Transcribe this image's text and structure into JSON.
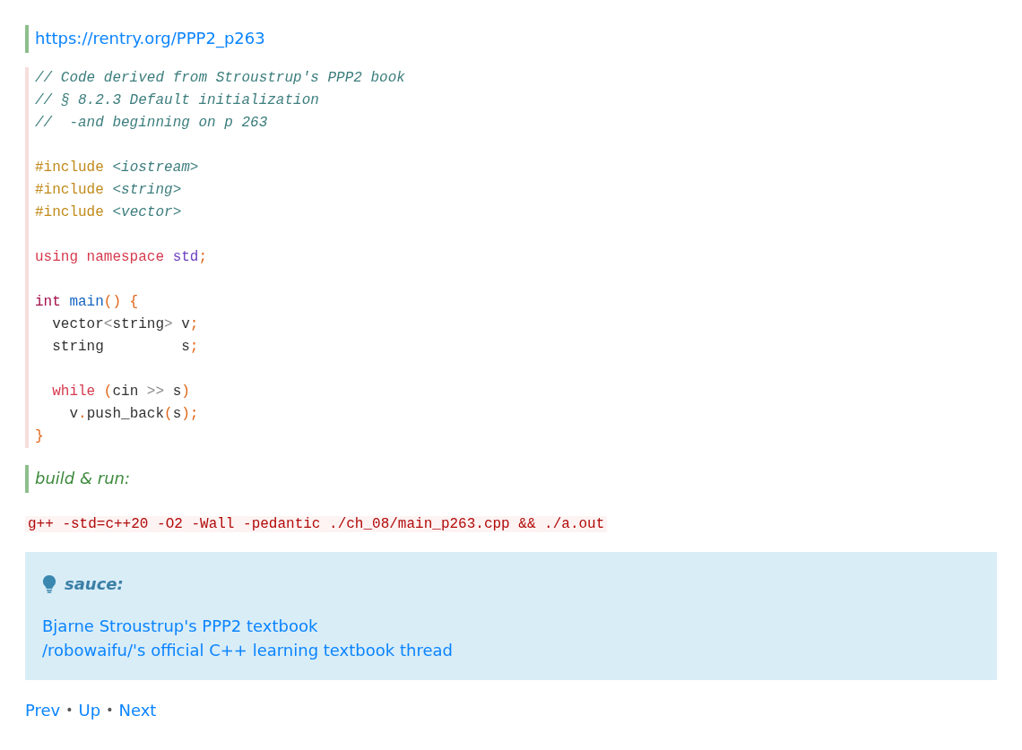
{
  "source_link": "https://rentry.org/PPP2_p263",
  "code": {
    "lines": [
      {
        "kind": "code",
        "tokens": [
          {
            "kind": "comment",
            "text": "// Code derived from Stroustrup's PPP2 book"
          }
        ]
      },
      {
        "kind": "code",
        "tokens": [
          {
            "kind": "comment",
            "text": "// § 8.2.3 Default initialization"
          }
        ]
      },
      {
        "kind": "code",
        "tokens": [
          {
            "kind": "comment",
            "text": "//  -and beginning on p 263"
          }
        ]
      },
      {
        "kind": "blank"
      },
      {
        "kind": "code",
        "tokens": [
          {
            "kind": "preproc",
            "text": "#include "
          },
          {
            "kind": "header",
            "text": "<iostream>"
          }
        ]
      },
      {
        "kind": "code",
        "tokens": [
          {
            "kind": "preproc",
            "text": "#include "
          },
          {
            "kind": "header",
            "text": "<string>"
          }
        ]
      },
      {
        "kind": "code",
        "tokens": [
          {
            "kind": "preproc",
            "text": "#include "
          },
          {
            "kind": "header",
            "text": "<vector>"
          }
        ]
      },
      {
        "kind": "blank"
      },
      {
        "kind": "code",
        "tokens": [
          {
            "kind": "keyword",
            "text": "using namespace "
          },
          {
            "kind": "namespace",
            "text": "std"
          },
          {
            "kind": "punct",
            "text": ";"
          }
        ]
      },
      {
        "kind": "blank"
      },
      {
        "kind": "code",
        "tokens": [
          {
            "kind": "type",
            "text": "int "
          },
          {
            "kind": "function",
            "text": "main"
          },
          {
            "kind": "punct",
            "text": "() {"
          }
        ]
      },
      {
        "kind": "code",
        "tokens": [
          {
            "kind": "plain",
            "text": "  vector"
          },
          {
            "kind": "operator",
            "text": "<"
          },
          {
            "kind": "plain",
            "text": "string"
          },
          {
            "kind": "operator",
            "text": ">"
          },
          {
            "kind": "plain",
            "text": " v"
          },
          {
            "kind": "punct",
            "text": ";"
          }
        ]
      },
      {
        "kind": "code",
        "tokens": [
          {
            "kind": "plain",
            "text": "  string         s"
          },
          {
            "kind": "punct",
            "text": ";"
          }
        ]
      },
      {
        "kind": "blank"
      },
      {
        "kind": "code",
        "tokens": [
          {
            "kind": "keyword",
            "text": "  while "
          },
          {
            "kind": "punct",
            "text": "("
          },
          {
            "kind": "plain",
            "text": "cin "
          },
          {
            "kind": "operator",
            "text": ">>"
          },
          {
            "kind": "plain",
            "text": " s"
          },
          {
            "kind": "punct",
            "text": ")"
          }
        ]
      },
      {
        "kind": "code",
        "tokens": [
          {
            "kind": "plain",
            "text": "    v"
          },
          {
            "kind": "punct",
            "text": "."
          },
          {
            "kind": "plain",
            "text": "push_back"
          },
          {
            "kind": "punct",
            "text": "("
          },
          {
            "kind": "plain",
            "text": "s"
          },
          {
            "kind": "punct",
            "text": ");"
          }
        ]
      },
      {
        "kind": "code",
        "tokens": [
          {
            "kind": "punct",
            "text": "}"
          }
        ]
      }
    ]
  },
  "build_label": "build & run:",
  "command": "g++ -std=c++20 -O2 -Wall -pedantic ./ch_08/main_p263.cpp && ./a.out",
  "note": {
    "title": "sauce:",
    "links": [
      "Bjarne Stroustrup's PPP2 textbook",
      "/robowaifu/'s official C++ learning textbook thread"
    ]
  },
  "nav": {
    "links": [
      "Prev",
      "Up",
      "Next"
    ],
    "separator": "•"
  }
}
